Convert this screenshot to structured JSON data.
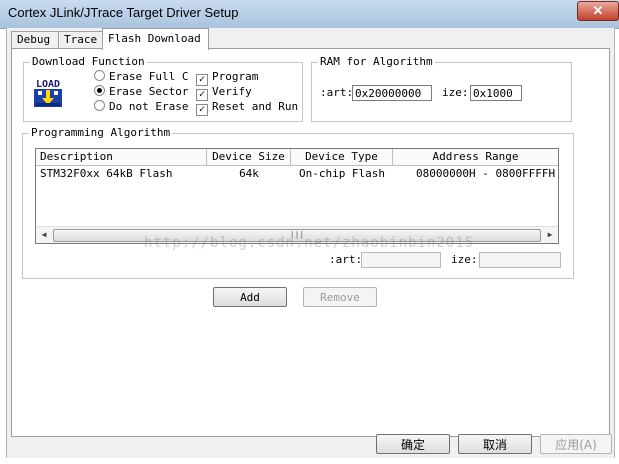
{
  "window": {
    "title": "Cortex JLink/JTrace Target Driver Setup",
    "close_glyph": "✕"
  },
  "tabs": [
    {
      "label": "Debug"
    },
    {
      "label": "Trace"
    },
    {
      "label": "Flash Download"
    }
  ],
  "download_function": {
    "title": "Download Function",
    "icon": "load-icon",
    "icon_text": "LOAD",
    "radios": [
      {
        "label": "Erase Full C",
        "selected": false
      },
      {
        "label": "Erase Sector",
        "selected": true
      },
      {
        "label": "Do not Erase",
        "selected": false
      }
    ],
    "checks": [
      {
        "label": "Program",
        "checked": true
      },
      {
        "label": "Verify",
        "checked": true
      },
      {
        "label": "Reset and Run",
        "checked": true
      }
    ]
  },
  "ram": {
    "title": "RAM for Algorithm",
    "start_label": ":art:",
    "start_value": "0x20000000",
    "size_label": "ize:",
    "size_value": "0x1000"
  },
  "programming": {
    "title": "Programming Algorithm",
    "columns": [
      "Description",
      "Device Size",
      "Device Type",
      "Address Range"
    ],
    "rows": [
      {
        "description": "STM32F0xx 64kB Flash",
        "size": "64k",
        "type": "On-chip Flash",
        "range": "08000000H - 0800FFFFH"
      }
    ],
    "start_label": ":art:",
    "start_value": "",
    "size_label": "ize:",
    "size_value": ""
  },
  "buttons": {
    "add": "Add",
    "remove": "Remove",
    "ok": "确定",
    "cancel": "取消",
    "apply": "应用(A)"
  },
  "watermark": "http://blog.csdn.net/zhaobinbin2015"
}
